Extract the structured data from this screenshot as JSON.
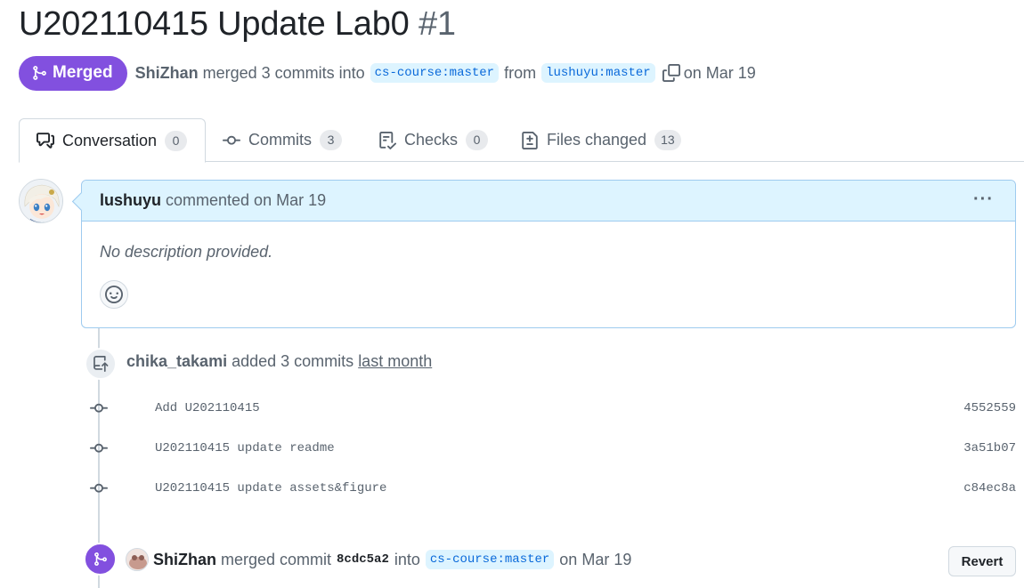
{
  "pr": {
    "title": "U202110415 Update Lab0",
    "number": "#1",
    "status": "Merged",
    "merger": "ShiZhan",
    "merge_text": "merged 3 commits into",
    "base_branch": "cs-course:master",
    "from_text": "from",
    "head_branch": "lushuyu:master",
    "date_text": "on Mar 19"
  },
  "tabs": [
    {
      "label": "Conversation",
      "count": "0",
      "icon": "comment-discussion-icon"
    },
    {
      "label": "Commits",
      "count": "3",
      "icon": "git-commit-icon"
    },
    {
      "label": "Checks",
      "count": "0",
      "icon": "checklist-icon"
    },
    {
      "label": "Files changed",
      "count": "13",
      "icon": "file-diff-icon"
    }
  ],
  "comment": {
    "author": "lushuyu",
    "meta": "commented on Mar 19",
    "body": "No description provided."
  },
  "commit_event": {
    "author": "chika_takami",
    "text": "added 3 commits",
    "time": "last month",
    "commits": [
      {
        "message": "Add U202110415",
        "sha": "4552559"
      },
      {
        "message": "U202110415 update readme",
        "sha": "3a51b07"
      },
      {
        "message": "U202110415 update assets&figure",
        "sha": "c84ec8a"
      }
    ]
  },
  "merge_event": {
    "author": "ShiZhan",
    "text": "merged commit",
    "sha": "8cdc5a2",
    "into": "into",
    "branch": "cs-course:master",
    "date": "on Mar 19",
    "revert_label": "Revert"
  },
  "colors": {
    "merged_purple": "#8250df",
    "link_blue": "#0969da",
    "branch_bg": "#ddf4ff",
    "comment_header_bg": "#ddf4ff"
  }
}
